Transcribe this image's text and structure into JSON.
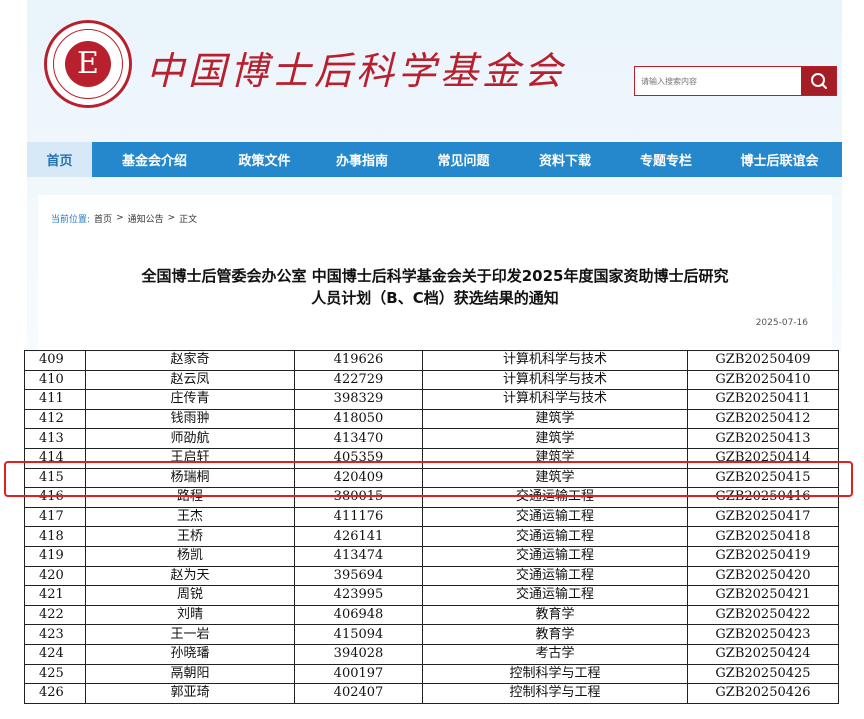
{
  "site": {
    "name": "中国博士后科学基金会",
    "logo_mark": "E",
    "brand_color": "#b8202d"
  },
  "search": {
    "placeholder": "请输入搜索内容",
    "icon": "search-icon"
  },
  "nav": {
    "items": [
      "首页",
      "基金会介绍",
      "政策文件",
      "办事指南",
      "常见问题",
      "资料下载",
      "专题专栏",
      "博士后联谊会"
    ],
    "active_index": 0,
    "color": "#2588cc"
  },
  "breadcrumb": {
    "label": "当前位置:",
    "items": [
      "首页",
      "通知公告",
      "正文"
    ],
    "separator": ">"
  },
  "article": {
    "title_line1": "全国博士后管委会办公室 中国博士后科学基金会关于印发2025年度国家资助博士后研究",
    "title_line2": "人员计划（B、C档）获选结果的通知",
    "date": "2025-07-16"
  },
  "table": {
    "rows": [
      [
        "409",
        "赵家奇",
        "419626",
        "计算机科学与技术",
        "GZB20250409"
      ],
      [
        "410",
        "赵云凤",
        "422729",
        "计算机科学与技术",
        "GZB20250410"
      ],
      [
        "411",
        "庄传青",
        "398329",
        "计算机科学与技术",
        "GZB20250411"
      ],
      [
        "412",
        "钱雨翀",
        "418050",
        "建筑学",
        "GZB20250412"
      ],
      [
        "413",
        "师劭航",
        "413470",
        "建筑学",
        "GZB20250413"
      ],
      [
        "414",
        "王启轩",
        "405359",
        "建筑学",
        "GZB20250414"
      ],
      [
        "415",
        "杨瑞桐",
        "420409",
        "建筑学",
        "GZB20250415"
      ],
      [
        "416",
        "路程",
        "380015",
        "交通运输工程",
        "GZB20250416"
      ],
      [
        "417",
        "王杰",
        "411176",
        "交通运输工程",
        "GZB20250417"
      ],
      [
        "418",
        "王桥",
        "426141",
        "交通运输工程",
        "GZB20250418"
      ],
      [
        "419",
        "杨凯",
        "413474",
        "交通运输工程",
        "GZB20250419"
      ],
      [
        "420",
        "赵为天",
        "395694",
        "交通运输工程",
        "GZB20250420"
      ],
      [
        "421",
        "周锐",
        "423995",
        "交通运输工程",
        "GZB20250421"
      ],
      [
        "422",
        "刘晴",
        "406948",
        "教育学",
        "GZB20250422"
      ],
      [
        "423",
        "王一岩",
        "415094",
        "教育学",
        "GZB20250423"
      ],
      [
        "424",
        "孙晓璠",
        "394028",
        "考古学",
        "GZB20250424"
      ],
      [
        "425",
        "鬲朝阳",
        "400197",
        "控制科学与工程",
        "GZB20250425"
      ],
      [
        "426",
        "郭亚琦",
        "402407",
        "控制科学与工程",
        "GZB20250426"
      ]
    ],
    "highlighted_row": "415",
    "highlight_color": "#e02020"
  }
}
